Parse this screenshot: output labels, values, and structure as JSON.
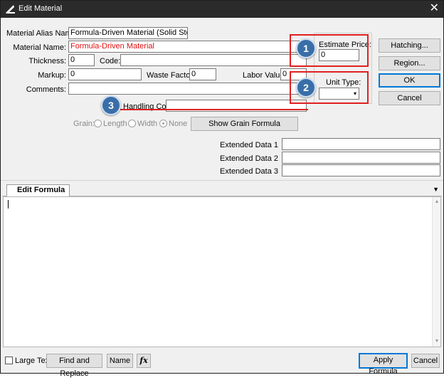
{
  "window": {
    "title": "Edit Material",
    "close_glyph": "✕"
  },
  "fields": {
    "alias_label": "Material Alias Name:",
    "alias_value": "Formula-Driven Material (Solid Stock)",
    "name_label": "Material Name:",
    "name_value": "Formula-Driven Material",
    "thickness_label": "Thickness:",
    "thickness_value": "0",
    "code_label": "Code:",
    "code_value": "",
    "markup_label": "Markup:",
    "markup_value": "0",
    "waste_label": "Waste Factor:",
    "waste_value": "0",
    "labor_label": "Labor Value:",
    "labor_value": "0",
    "comments_label": "Comments:",
    "comments_value": "",
    "handling_label": "Handling Code:",
    "handling_value": "",
    "estimate_label": "Estimate Price:",
    "estimate_value": "0",
    "unit_label": "Unit Type:",
    "unit_value": ""
  },
  "grain": {
    "label": "Grain:",
    "options": [
      "Length",
      "Width",
      "None"
    ],
    "selected": "None"
  },
  "buttons": {
    "hatching": "Hatching...",
    "region": "Region...",
    "ok": "OK",
    "cancel": "Cancel",
    "show_grain": "Show Grain Formula",
    "find_replace": "Find and Replace",
    "name": "Name",
    "fx": "fx",
    "apply": "Apply Formula",
    "cancel_bottom": "Cancel"
  },
  "extended": [
    {
      "label": "Extended Data 1",
      "value": ""
    },
    {
      "label": "Extended Data 2",
      "value": ""
    },
    {
      "label": "Extended Data 3",
      "value": ""
    }
  ],
  "tabs": {
    "edit_formula": "Edit Formula"
  },
  "bottom": {
    "large_text": "Large Text"
  },
  "callouts": {
    "one": "1",
    "two": "2",
    "three": "3"
  },
  "colors": {
    "accent": "#0078d7",
    "callout": "#3a6ea8",
    "highlight": "#e02020",
    "titlebar": "#2b2b2b"
  }
}
